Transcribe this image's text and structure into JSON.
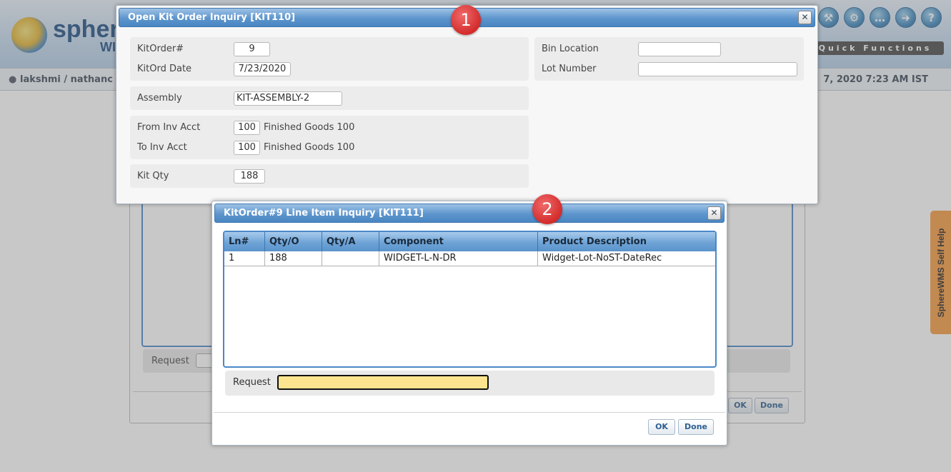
{
  "app": {
    "brand": "sphere",
    "brand_sub": "WI",
    "icons": [
      "tools-icon",
      "gear-icon",
      "chat-icon",
      "logout-icon",
      "help-icon"
    ],
    "quick_functions_label": "Quick Functions",
    "user": "lakshmi / nathanc",
    "datetime": "7, 2020 7:23 AM IST",
    "bg_request_label": "Request",
    "bg_ok": "OK",
    "bg_done": "Done",
    "self_help": "SphereWMS Self Help"
  },
  "dialog1": {
    "title": "Open Kit Order Inquiry [KIT110]",
    "marker": "1",
    "kitorder_label": "KitOrder#",
    "kitorder_value": "9",
    "kitord_date_label": "KitOrd Date",
    "kitord_date_value": "7/23/2020",
    "assembly_label": "Assembly",
    "assembly_value": "KIT-ASSEMBLY-2",
    "from_inv_label": "From Inv Acct",
    "from_inv_value": "100",
    "from_inv_desc": "Finished Goods 100",
    "to_inv_label": "To Inv Acct",
    "to_inv_value": "100",
    "to_inv_desc": "Finished Goods 100",
    "kit_qty_label": "Kit Qty",
    "kit_qty_value": "188",
    "bin_location_label": "Bin Location",
    "bin_location_value": "",
    "lot_number_label": "Lot Number",
    "lot_number_value": ""
  },
  "dialog2": {
    "title": "KitOrder#9 Line Item Inquiry [KIT111]",
    "marker": "2",
    "columns": [
      "Ln#",
      "Qty/O",
      "Qty/A",
      "Component",
      "Product Description"
    ],
    "rows": [
      {
        "ln": "1",
        "qty_o": "188",
        "qty_a": "",
        "component": "WIDGET-L-N-DR",
        "description": "Widget-Lot-NoST-DateRec"
      }
    ],
    "request_label": "Request",
    "request_value": "",
    "ok_label": "OK",
    "done_label": "Done"
  },
  "colors": {
    "titlebar": "#5d95cc",
    "request_highlight": "#fde58f",
    "marker": "#d42b2b",
    "self_help": "#f59a3e"
  }
}
